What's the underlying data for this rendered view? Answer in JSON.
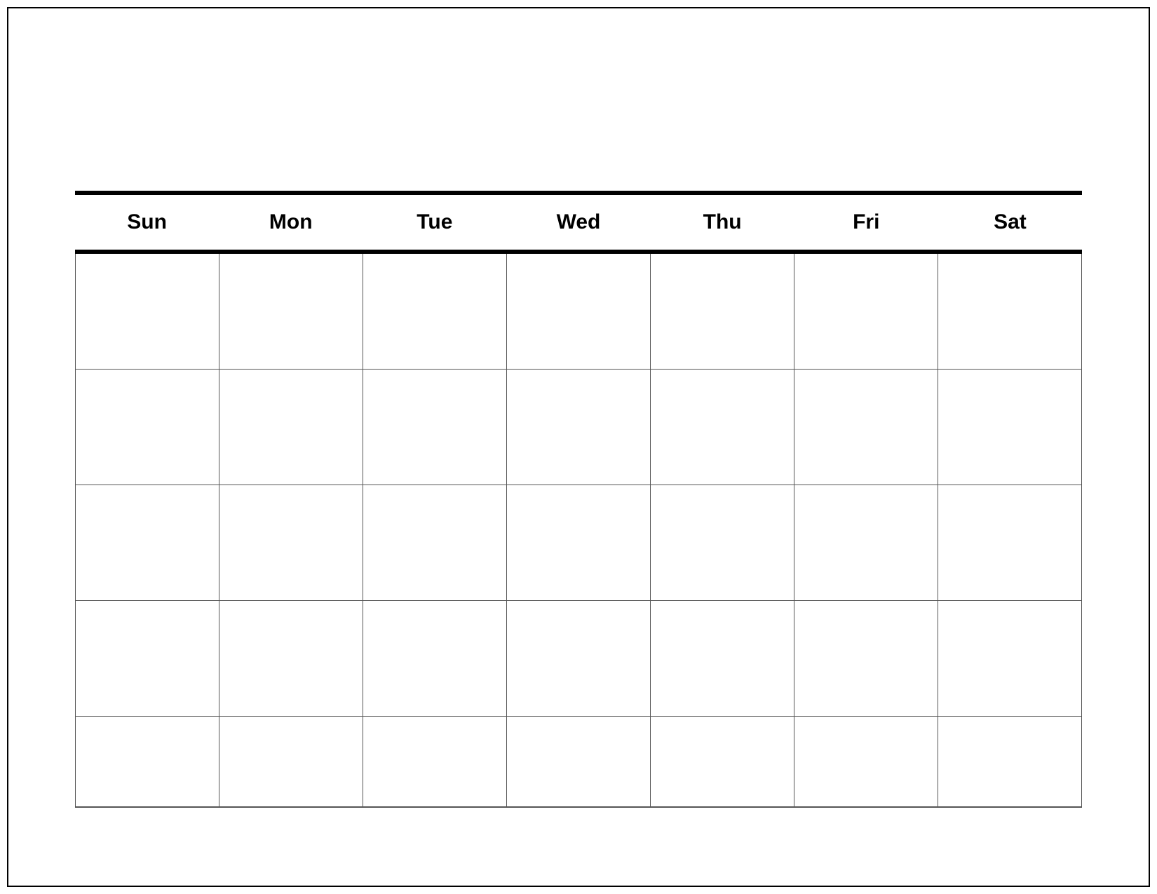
{
  "calendar": {
    "days": [
      "Sun",
      "Mon",
      "Tue",
      "Wed",
      "Thu",
      "Fri",
      "Sat"
    ],
    "rows": 5,
    "cols": 7
  }
}
